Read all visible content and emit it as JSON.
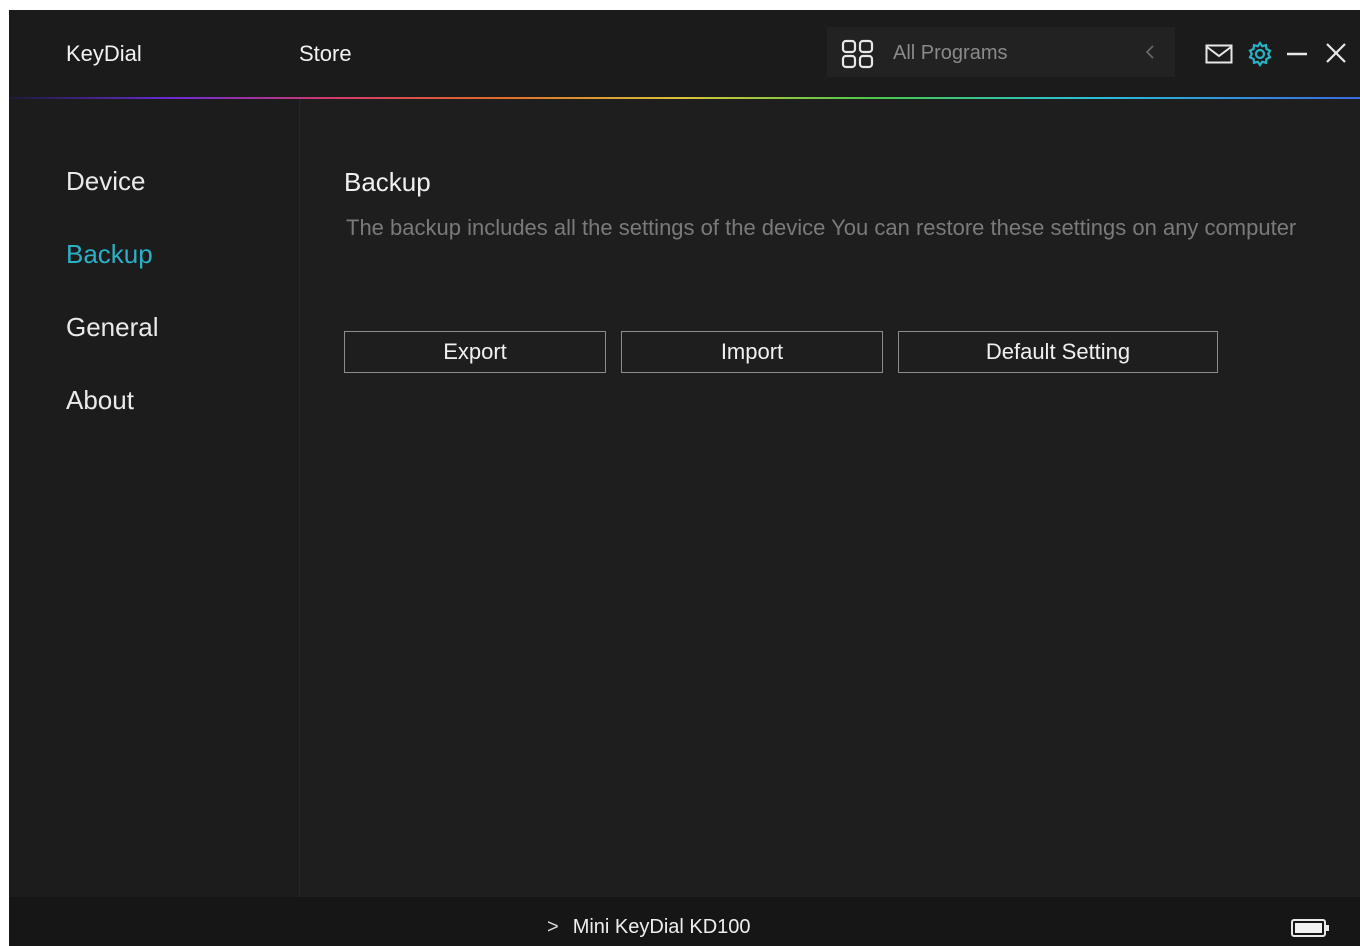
{
  "titlebar": {
    "app_name": "KeyDial",
    "store_label": "Store",
    "program_selector": {
      "label": "All Programs",
      "icon": "grid-icon",
      "arrow_icon": "chevron-left-icon"
    },
    "icons": [
      "mail-icon",
      "gear-icon",
      "minimize-icon",
      "close-icon"
    ]
  },
  "sidebar": {
    "items": [
      {
        "label": "Device",
        "active": false
      },
      {
        "label": "Backup",
        "active": true
      },
      {
        "label": "General",
        "active": false
      },
      {
        "label": "About",
        "active": false
      }
    ]
  },
  "main": {
    "title": "Backup",
    "description": "The backup includes all the settings of the device You can restore these settings  on any computer",
    "buttons": {
      "export": "Export",
      "import": "Import",
      "default": "Default Setting"
    }
  },
  "statusbar": {
    "device_name": "Mini KeyDial KD100",
    "chevron": ">",
    "battery_icon": "battery-icon"
  },
  "colors": {
    "accent": "#2ab1c6",
    "background": "#1e1e1e",
    "text": "#e6e6e6",
    "muted_text": "#7a7a7a"
  }
}
